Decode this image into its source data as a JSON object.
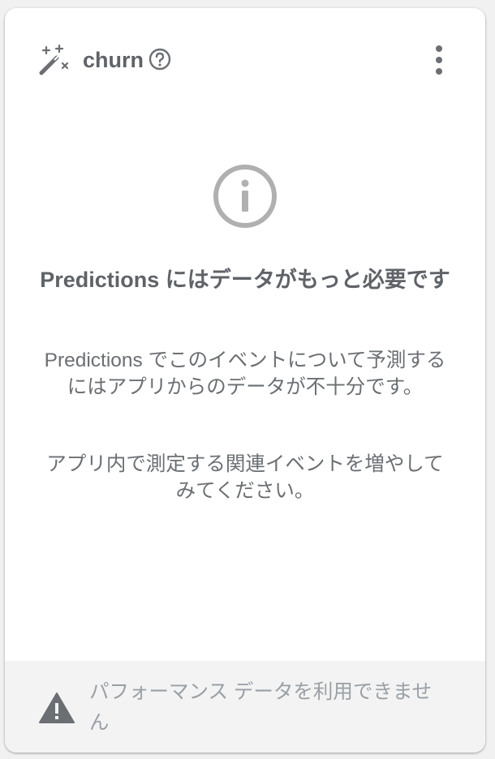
{
  "header": {
    "icon": "magic-wand-icon",
    "title": "churn",
    "help_icon": "help-circle-icon",
    "menu_icon": "more-vert-icon"
  },
  "body": {
    "icon": "info-icon",
    "heading": "Predictions にはデータがもっと必要です",
    "description": "Predictions でこのイベントについて予測するにはアプリからのデータが不十分です。",
    "suggestion": "アプリ内で測定する関連イベントを増やしてみてください。"
  },
  "footer": {
    "icon": "warning-icon",
    "text": "パフォーマンス データを利用できません"
  },
  "colors": {
    "icon_gray": "#6b6f73",
    "text_dark": "#5f6368",
    "footer_bg": "#f3f3f3",
    "footer_text": "#9aa0a6"
  }
}
